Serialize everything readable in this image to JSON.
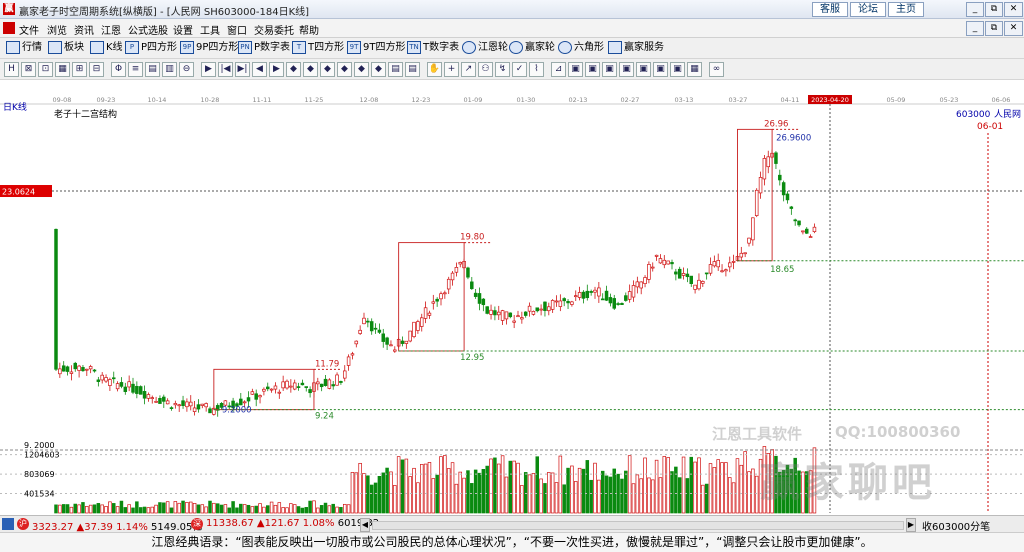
{
  "window": {
    "title": "赢家老子时空周期系统[纵横版] - [人民网  SH603000-184日K线]",
    "top_links": [
      "客服",
      "论坛",
      "主页"
    ],
    "controls": [
      "_",
      "⧉",
      "✕"
    ]
  },
  "menubar": {
    "items": [
      "文件",
      "浏览",
      "资讯",
      "江恩",
      "公式选股",
      "设置",
      "工具",
      "窗口",
      "交易委托",
      "帮助"
    ],
    "controls": [
      "_",
      "⧉",
      "✕"
    ]
  },
  "toolbar1": {
    "items": [
      {
        "icon": "grid-icon",
        "label": "行情"
      },
      {
        "icon": "blocks-icon",
        "label": "板块"
      },
      {
        "icon": "candle-icon",
        "label": "K线"
      },
      {
        "icon": "p-square-icon",
        "label": "P四方形"
      },
      {
        "icon": "9p-square-icon",
        "label": "9P四方形"
      },
      {
        "icon": "pn-square-icon",
        "label": "P数字表"
      },
      {
        "icon": "t-square-icon",
        "label": "T四方形"
      },
      {
        "icon": "9t-square-icon",
        "label": "9T四方形"
      },
      {
        "icon": "t-table-icon",
        "label": "T数字表"
      },
      {
        "icon": "gann-wheel-icon",
        "label": "江恩轮"
      },
      {
        "icon": "winner-wheel-icon",
        "label": "赢家轮"
      },
      {
        "icon": "hexagon-icon",
        "label": "六角形"
      },
      {
        "icon": "service-icon",
        "label": "赢家服务"
      }
    ]
  },
  "toolbar2": {
    "icons": [
      "H",
      "⊠",
      "⊡",
      "▦",
      "⊞",
      "⊟",
      "Φ",
      "≡",
      "▤",
      "▥",
      "⊖",
      "▶",
      "|◀",
      "▶|",
      "◀",
      "▶",
      "◆",
      "◆",
      "◆",
      "◆",
      "◆",
      "◆",
      "▤",
      "▤",
      "✋",
      "+",
      "↗",
      "⚇",
      "↯",
      "✓",
      "⌇",
      "⊿",
      "▣",
      "▣",
      "▣",
      "▣",
      "▣",
      "▣",
      "▣",
      "▦",
      "∞"
    ]
  },
  "chart_header": {
    "period_label": "日K线",
    "structure_label": "老子十二宫结构",
    "stock_code": "603000",
    "stock_name": "人民网",
    "date_cursor": "06-01",
    "price_cursor": "23.0624"
  },
  "chart_data": {
    "type": "candlestick",
    "x_dates": [
      "09-08",
      "09-23",
      "10-14",
      "10-28",
      "11-11",
      "11-25",
      "12-08",
      "12-23",
      "01-09",
      "01-30",
      "02-13",
      "02-27",
      "03-13",
      "03-27",
      "04-11",
      "2023-04-20",
      "05-09",
      "05-23",
      "06-06"
    ],
    "highlight_date": "2023-04-20",
    "ylim": [
      6.5,
      28.5
    ],
    "volume_ticks": [
      1204603,
      803069,
      401534
    ],
    "price_tick": "9. 2000",
    "boxes": [
      {
        "start_index": 41,
        "end_index": 67,
        "high": 11.79,
        "low": 9.24
      },
      {
        "start_index": 89,
        "end_index": 106,
        "high": 19.8,
        "low": 12.95
      },
      {
        "start_index": 177,
        "end_index": 186,
        "high": 26.96,
        "low": 18.65
      }
    ],
    "price_labels": [
      "11.79",
      "9.24",
      "9.2000",
      "19.80",
      "12.95",
      "26.96",
      "26.9600",
      "18.65"
    ],
    "watermark": {
      "software": "江恩工具软件",
      "qq": "QQ:100800360",
      "brand": "赢家聊吧"
    }
  },
  "status_bar": {
    "sh_index": "3323.27",
    "sh_change": "▲37.39",
    "sh_pct": "1.14%",
    "sh_amount": "5149.05亿",
    "sz_index": "11338.67",
    "sz_change": "▲121.67",
    "sz_pct": "1.08%",
    "sz_amount": "6019.82",
    "right_text": "收603000分笔"
  },
  "bottom_quote": "江恩经典语录：“图表能反映出一切股市或公司股民的总体心理状况”，“不要一次性买进，傲慢就是罪过”，“调整只会让股市更加健康”。"
}
